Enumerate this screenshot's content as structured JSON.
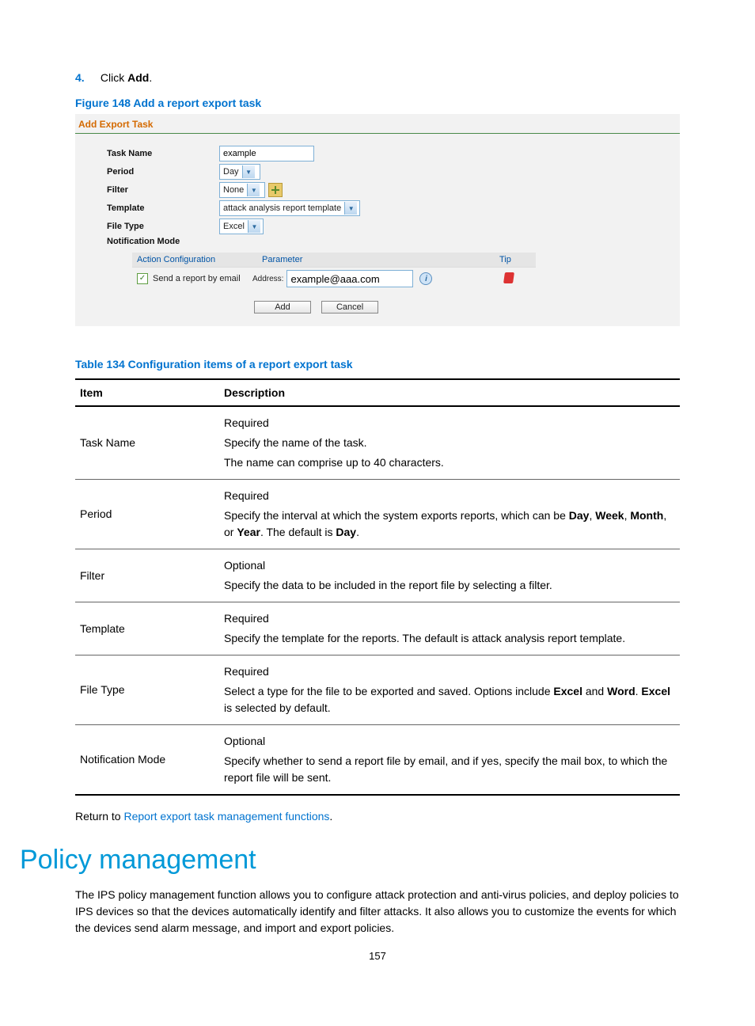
{
  "step": {
    "num": "4.",
    "pre": "Click ",
    "bold": "Add",
    "post": "."
  },
  "figure_caption": "Figure 148 Add a report export task",
  "screenshot": {
    "title": "Add Export Task",
    "labels": {
      "task_name": "Task Name",
      "period": "Period",
      "filter": "Filter",
      "template": "Template",
      "file_type": "File Type",
      "notification": "Notification Mode"
    },
    "values": {
      "task_name": "example",
      "period": "Day",
      "filter": "None",
      "template": "attack analysis report template",
      "file_type": "Excel",
      "address": "example@aaa.com"
    },
    "notif_head": {
      "c1": "Action Configuration",
      "c2": "Parameter",
      "c3": "Tip"
    },
    "notif_row": {
      "label": "Send a report by email",
      "addr_label": "Address:"
    },
    "buttons": {
      "add": "Add",
      "cancel": "Cancel"
    }
  },
  "table_caption": "Table 134 Configuration items of a report export task",
  "table": {
    "head": {
      "c1": "Item",
      "c2": "Description"
    },
    "rows": [
      {
        "item": "Task Name",
        "desc": "Required<br>Specify the name of the task.<br>The name can comprise up to 40 characters."
      },
      {
        "item": "Period",
        "desc": "Required<br>Specify the interval at which the system exports reports, which can be <b>Day</b>, <b>Week</b>, <b>Month</b>, or <b>Year</b>. The default is <b>Day</b>."
      },
      {
        "item": "Filter",
        "desc": "Optional<br>Specify the data to be included in the report file by selecting a filter."
      },
      {
        "item": "Template",
        "desc": "Required<br>Specify the template for the reports. The default is attack analysis report template."
      },
      {
        "item": "File Type",
        "desc": "Required<br>Select a type for the file to be exported and saved. Options include <b>Excel</b> and <b>Word</b>. <b>Excel</b> is selected by default."
      },
      {
        "item": "Notification Mode",
        "desc": "Optional<br>Specify whether to send a report file by email, and if yes, specify the mail box, to which the report file will be sent."
      }
    ]
  },
  "return": {
    "pre": "Return to ",
    "link": "Report export task management functions",
    "post": "."
  },
  "section_heading": "Policy management",
  "section_body": "The IPS policy management function allows you to configure attack protection and anti-virus policies, and deploy policies to IPS devices so that the devices automatically identify and filter attacks. It also allows you to customize the events for which the devices send alarm message, and import and export policies.",
  "page_number": "157"
}
